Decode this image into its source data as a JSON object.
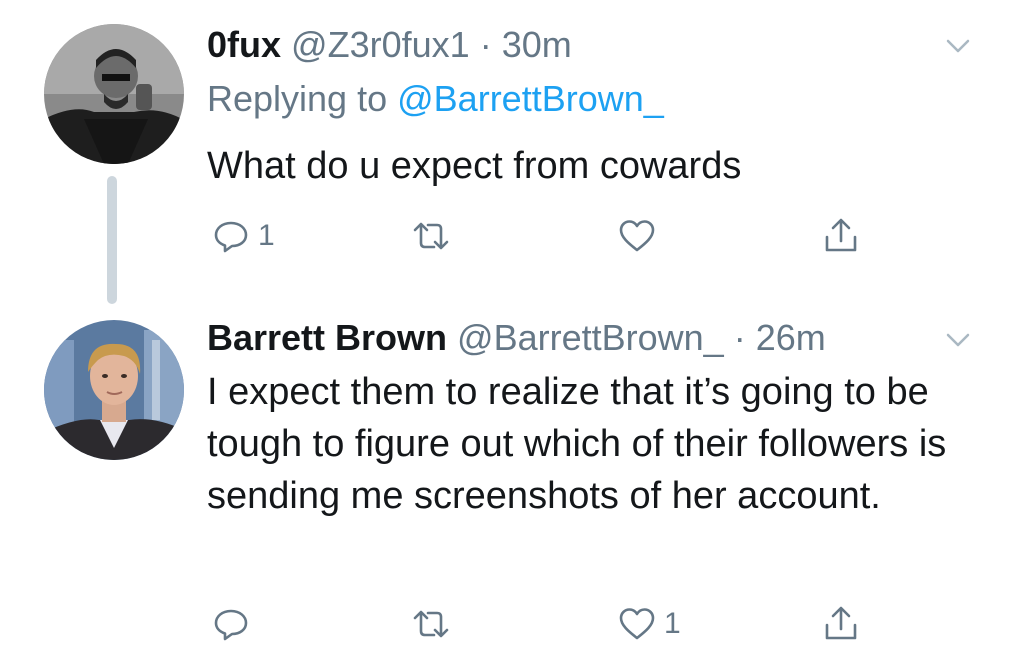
{
  "tweets": [
    {
      "name": "0fux",
      "handle": "@Z3r0fux1",
      "separator": "·",
      "time": "30m",
      "replying_prefix": "Replying to",
      "replying_to": "@BarrettBrown_",
      "text": "What do u expect from cowards",
      "reply_count": "1",
      "retweet_count": "",
      "like_count": ""
    },
    {
      "name": "Barrett Brown",
      "handle": "@BarrettBrown_",
      "separator": "·",
      "time": "26m",
      "text": "I expect them to realize that it’s going to be tough to figure out which of their followers is sending me screenshots of her account.",
      "reply_count": "",
      "retweet_count": "",
      "like_count": "1"
    }
  ],
  "colors": {
    "text": "#14171a",
    "secondary": "#657786",
    "link": "#1da1f2",
    "thread_line": "#cdd6dd"
  },
  "icons": [
    "chevron-down-icon",
    "reply-icon",
    "retweet-icon",
    "heart-icon",
    "share-icon"
  ]
}
